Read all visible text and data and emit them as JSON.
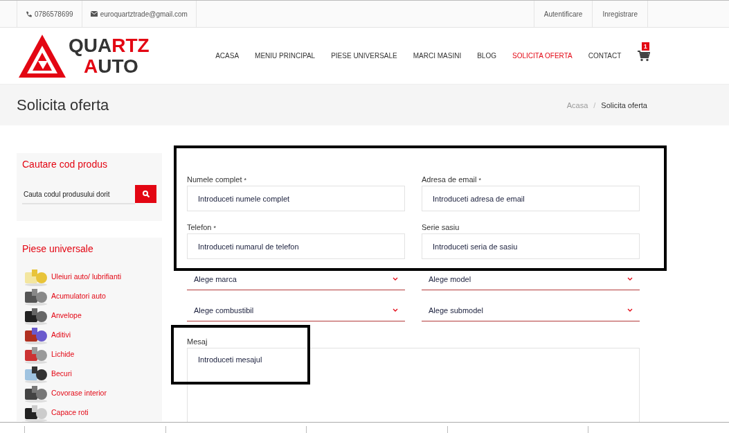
{
  "top_bar": {
    "phone": "0786578699",
    "email": "euroquartztrade@gmail.com",
    "links": [
      "Autentificare",
      "Inregistrare"
    ]
  },
  "logo": {
    "lines": [
      [
        {
          "text": "QUA",
          "accent": false
        },
        {
          "text": "RTZ",
          "accent": true
        }
      ],
      [
        {
          "text": "A",
          "accent": true
        },
        {
          "text": "UTO",
          "accent": false
        }
      ]
    ]
  },
  "nav": [
    {
      "label": "ACASA",
      "selected": false
    },
    {
      "label": "MENIU PRINCIPAL",
      "selected": false
    },
    {
      "label": "PIESE UNIVERSALE",
      "selected": false
    },
    {
      "label": "MARCI MASINI",
      "selected": false
    },
    {
      "label": "BLOG",
      "selected": false
    },
    {
      "label": "SOLICITA OFERTA",
      "selected": true
    },
    {
      "label": "CONTACT",
      "selected": false
    }
  ],
  "cart": {
    "count": "1"
  },
  "page_title": "Solicita oferta",
  "breadcrumb": [
    {
      "label": "Acasa",
      "current": false
    },
    {
      "label": "Solicita oferta",
      "current": true
    }
  ],
  "breadcrumb_separator": "/",
  "sidebar": {
    "search": {
      "title": "Cautare cod produs",
      "placeholder": "Cauta codul produsului dorit"
    },
    "categories": {
      "title": "Piese universale",
      "items": [
        "Uleiuri auto/ lubrifianti",
        "Acumulatori auto",
        "Anvelope",
        "Aditivi",
        "Lichide",
        "Becuri",
        "Covorase interior",
        "Capace roti"
      ]
    }
  },
  "form": {
    "fields": [
      {
        "kind": "input",
        "label": "Numele complet",
        "required": true,
        "placeholder": "Introduceti numele complet"
      },
      {
        "kind": "input",
        "label": "Adresa de email",
        "required": true,
        "placeholder": "Introduceti adresa de email"
      },
      {
        "kind": "input",
        "label": "Telefon",
        "required": true,
        "placeholder": "Introduceti numarul de telefon"
      },
      {
        "kind": "input",
        "label": "Serie sasiu",
        "required": false,
        "placeholder": "Introduceti seria de sasiu"
      },
      {
        "kind": "select",
        "value": "Alege marca"
      },
      {
        "kind": "select",
        "value": "Alege model"
      },
      {
        "kind": "select",
        "value": "Alege combustibil"
      },
      {
        "kind": "select",
        "value": "Alege submodel"
      },
      {
        "kind": "textarea",
        "label": "Mesaj",
        "placeholder": "Introduceti mesajul"
      }
    ],
    "required_mark": "*"
  }
}
